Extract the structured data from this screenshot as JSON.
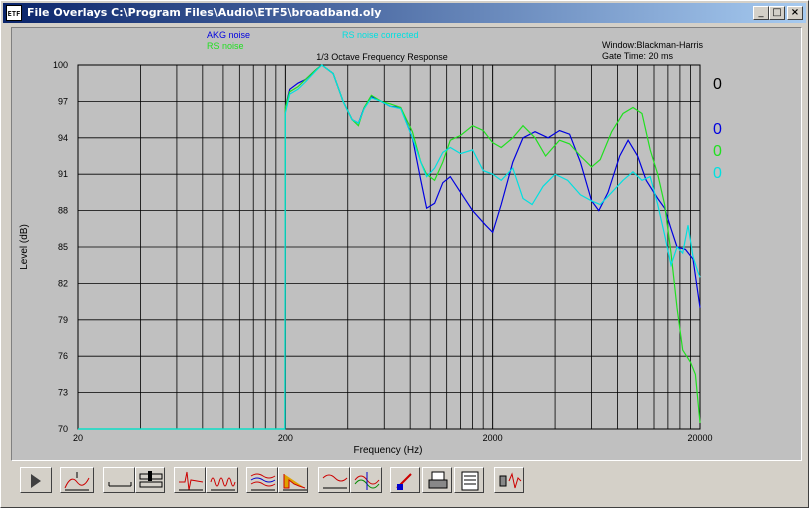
{
  "window": {
    "title": "File Overlays  C:\\Program Files\\Audio\\ETF5\\broadband.oly",
    "icon_label": "ETF",
    "controls": [
      "minimize",
      "maximize",
      "close"
    ]
  },
  "chart_data": {
    "type": "line",
    "title": "1/3 Octave Frequency Response",
    "xlabel": "Frequency (Hz)",
    "ylabel": "Level (dB)",
    "x_scale": "log",
    "xlim": [
      20,
      20000
    ],
    "ylim": [
      70,
      100
    ],
    "x_ticks": [
      "20",
      "200",
      "2000",
      "20000"
    ],
    "y_ticks": [
      "100",
      "97",
      "94",
      "91",
      "88",
      "85",
      "82",
      "79",
      "76",
      "73",
      "70"
    ],
    "grid": true,
    "info": [
      "Window:Blackman-Harris",
      "Gate Time: 20 ms"
    ],
    "series": [
      {
        "name": "AKG noise",
        "color": "#0000e0",
        "marker_value": "0",
        "points": [
          [
            200,
            96.5
          ],
          [
            210,
            98.0
          ],
          [
            230,
            98.5
          ],
          [
            250,
            98.8
          ],
          [
            280,
            99.6
          ],
          [
            300,
            100.0
          ],
          [
            340,
            99.3
          ],
          [
            380,
            97.0
          ],
          [
            420,
            95.5
          ],
          [
            450,
            95.2
          ],
          [
            480,
            96.5
          ],
          [
            520,
            97.4
          ],
          [
            580,
            97.0
          ],
          [
            640,
            96.6
          ],
          [
            720,
            96.5
          ],
          [
            820,
            94.0
          ],
          [
            900,
            90.5
          ],
          [
            960,
            88.2
          ],
          [
            1050,
            88.6
          ],
          [
            1150,
            90.3
          ],
          [
            1250,
            90.8
          ],
          [
            1400,
            89.5
          ],
          [
            1600,
            88.0
          ],
          [
            1850,
            86.8
          ],
          [
            2000,
            86.2
          ],
          [
            2200,
            88.5
          ],
          [
            2500,
            92.0
          ],
          [
            2800,
            94.0
          ],
          [
            3200,
            94.5
          ],
          [
            3700,
            94.0
          ],
          [
            4200,
            94.6
          ],
          [
            4700,
            94.3
          ],
          [
            5300,
            92.0
          ],
          [
            6000,
            88.8
          ],
          [
            6500,
            88.0
          ],
          [
            7200,
            89.5
          ],
          [
            8200,
            92.5
          ],
          [
            9000,
            93.8
          ],
          [
            10000,
            92.5
          ],
          [
            11000,
            90.5
          ],
          [
            12500,
            89.0
          ],
          [
            13500,
            88.2
          ],
          [
            14500,
            86.5
          ],
          [
            15500,
            85.0
          ],
          [
            17000,
            84.8
          ],
          [
            18500,
            84.0
          ],
          [
            20000,
            80.0
          ]
        ]
      },
      {
        "name": "RS noise",
        "color": "#20e020",
        "marker_value": "0",
        "points": [
          [
            20,
            70.0
          ],
          [
            199,
            70.0
          ],
          [
            200,
            96.5
          ],
          [
            210,
            97.8
          ],
          [
            230,
            98.2
          ],
          [
            250,
            98.8
          ],
          [
            280,
            99.6
          ],
          [
            300,
            100.0
          ],
          [
            340,
            99.3
          ],
          [
            380,
            97.0
          ],
          [
            420,
            95.5
          ],
          [
            450,
            95.0
          ],
          [
            480,
            96.5
          ],
          [
            520,
            97.5
          ],
          [
            580,
            97.0
          ],
          [
            640,
            96.8
          ],
          [
            720,
            96.5
          ],
          [
            820,
            94.5
          ],
          [
            900,
            92.0
          ],
          [
            960,
            91.0
          ],
          [
            1050,
            90.5
          ],
          [
            1150,
            92.0
          ],
          [
            1250,
            93.8
          ],
          [
            1400,
            94.2
          ],
          [
            1600,
            95.0
          ],
          [
            1800,
            94.6
          ],
          [
            2000,
            93.6
          ],
          [
            2200,
            93.2
          ],
          [
            2500,
            94.0
          ],
          [
            2800,
            95.0
          ],
          [
            3200,
            94.0
          ],
          [
            3600,
            92.5
          ],
          [
            4200,
            93.8
          ],
          [
            4700,
            93.5
          ],
          [
            5300,
            92.5
          ],
          [
            6000,
            91.6
          ],
          [
            6600,
            92.2
          ],
          [
            7500,
            94.5
          ],
          [
            8500,
            96.0
          ],
          [
            9500,
            96.5
          ],
          [
            10500,
            96.0
          ],
          [
            11500,
            93.0
          ],
          [
            12500,
            91.0
          ],
          [
            13500,
            88.5
          ],
          [
            14500,
            84.5
          ],
          [
            15500,
            80.0
          ],
          [
            16500,
            76.5
          ],
          [
            18000,
            75.5
          ],
          [
            19000,
            74.5
          ],
          [
            20000,
            70.5
          ]
        ]
      },
      {
        "name": "RS noise corrected",
        "color": "#00e0e0",
        "marker_value": "0",
        "points": [
          [
            20,
            70.0
          ],
          [
            199,
            70.0
          ],
          [
            200,
            96.0
          ],
          [
            210,
            97.6
          ],
          [
            230,
            98.0
          ],
          [
            250,
            98.6
          ],
          [
            280,
            99.5
          ],
          [
            300,
            100.0
          ],
          [
            340,
            99.3
          ],
          [
            380,
            97.0
          ],
          [
            420,
            95.5
          ],
          [
            450,
            95.2
          ],
          [
            480,
            96.4
          ],
          [
            520,
            97.3
          ],
          [
            580,
            97.0
          ],
          [
            640,
            96.6
          ],
          [
            720,
            96.4
          ],
          [
            820,
            94.0
          ],
          [
            900,
            92.0
          ],
          [
            960,
            90.8
          ],
          [
            1050,
            91.5
          ],
          [
            1150,
            92.8
          ],
          [
            1250,
            93.2
          ],
          [
            1400,
            92.7
          ],
          [
            1600,
            93.0
          ],
          [
            1800,
            91.3
          ],
          [
            2000,
            91.0
          ],
          [
            2200,
            90.5
          ],
          [
            2500,
            91.5
          ],
          [
            2800,
            89.0
          ],
          [
            3100,
            88.5
          ],
          [
            3500,
            90.0
          ],
          [
            4000,
            91.0
          ],
          [
            4600,
            90.5
          ],
          [
            5300,
            89.3
          ],
          [
            6000,
            88.8
          ],
          [
            6600,
            88.5
          ],
          [
            7500,
            89.5
          ],
          [
            8500,
            90.5
          ],
          [
            9500,
            91.2
          ],
          [
            10500,
            90.5
          ],
          [
            11500,
            90.8
          ],
          [
            12500,
            88.5
          ],
          [
            13500,
            86.0
          ],
          [
            14500,
            83.5
          ],
          [
            15500,
            85.0
          ],
          [
            16500,
            84.5
          ],
          [
            17500,
            86.8
          ],
          [
            18500,
            84.2
          ],
          [
            19500,
            83.0
          ],
          [
            20000,
            82.5
          ]
        ]
      }
    ]
  },
  "toolbar": {
    "buttons": [
      {
        "name": "play-button",
        "icon": "play-icon"
      },
      {
        "name": "overlay-button",
        "icon": "overlay-icon"
      },
      {
        "name": "baseline-button",
        "icon": "baseline-icon"
      },
      {
        "name": "cursor-button",
        "icon": "cursor-icon"
      },
      {
        "name": "impulse-button",
        "icon": "impulse-icon"
      },
      {
        "name": "step-button",
        "icon": "step-icon"
      },
      {
        "name": "multi-overlay-button",
        "icon": "multi-overlay-icon"
      },
      {
        "name": "decay-button",
        "icon": "decay-icon"
      },
      {
        "name": "freq-response-button",
        "icon": "freq-response-icon"
      },
      {
        "name": "waterfall-button",
        "icon": "waterfall-icon"
      },
      {
        "name": "color-button",
        "icon": "color-icon"
      },
      {
        "name": "print-button",
        "icon": "printer-icon"
      },
      {
        "name": "notes-button",
        "icon": "notes-icon"
      },
      {
        "name": "speaker-button",
        "icon": "speaker-icon"
      }
    ]
  }
}
